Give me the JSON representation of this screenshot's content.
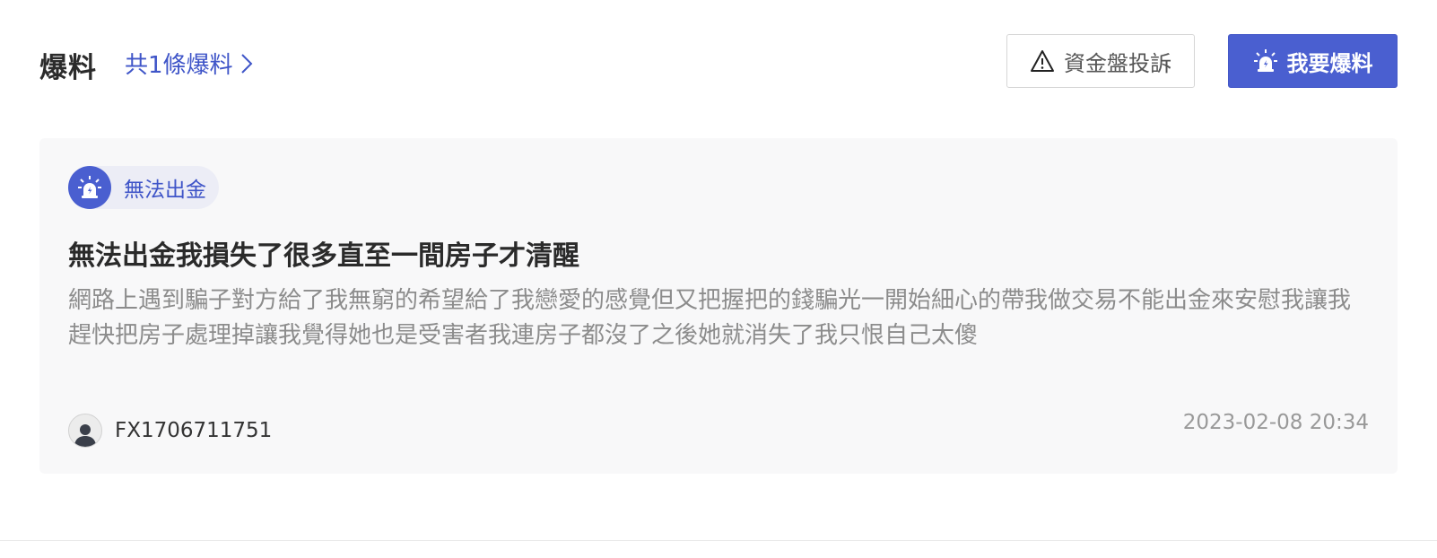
{
  "header": {
    "title": "爆料",
    "count_text": "共1條爆料",
    "complaint_label": "資金盤投訴",
    "report_label": "我要爆料"
  },
  "post": {
    "tag": "無法出金",
    "title": "無法出金我損失了很多直至一間房子才清醒",
    "body": "網路上遇到騙子對方給了我無窮的希望給了我戀愛的感覺但又把握把的錢騙光一開始細心的帶我做交易不能出金來安慰我讓我趕快把房子處理掉讓我覺得她也是受害者我連房子都沒了之後她就消失了我只恨自己太傻",
    "author": "FX1706711751",
    "timestamp": "2023-02-08 20:34"
  },
  "icons": {
    "count_chevron": "chevron-right-icon",
    "complaint": "warning-triangle-icon",
    "report": "alarm-siren-icon",
    "tag": "alarm-siren-icon",
    "avatar": "user-silhouette-icon"
  },
  "colors": {
    "accent": "#4a5fd0",
    "link": "#3f55c8",
    "card_bg": "#f8f8f9",
    "muted_text": "#8c8c8c"
  }
}
